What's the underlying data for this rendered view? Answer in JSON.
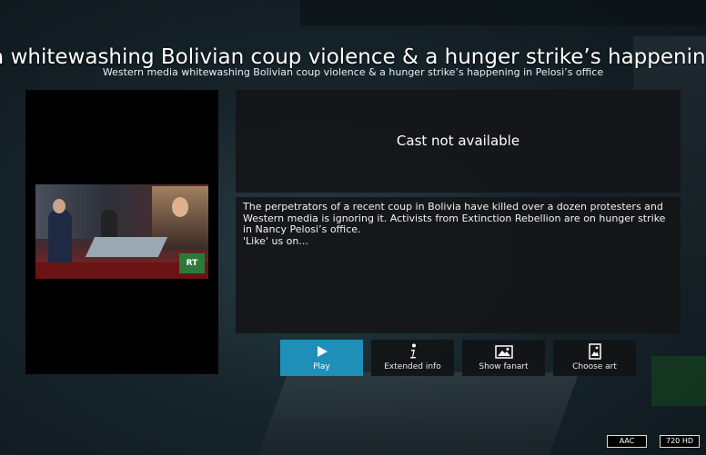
{
  "title": "Western media whitewashing Bolivian coup violence & a hunger strike’s happening in Pelosi’s office",
  "subtitle": "Western media whitewashing Bolivian coup violence & a hunger strike’s happening in Pelosi’s office",
  "thumbnail": {
    "logo_text": "RT"
  },
  "cast": {
    "message": "Cast not available"
  },
  "plot": {
    "text": "The perpetrators of a recent coup in Bolivia have killed over a dozen protesters and Western media is ignoring it. Activists from Extinction Rebellion are on hunger strike in Nancy Pelosi’s office.\n'Like' us on..."
  },
  "buttons": [
    {
      "label": "Play",
      "icon": "play-icon",
      "active": true
    },
    {
      "label": "Extended info",
      "icon": "info-icon",
      "active": false
    },
    {
      "label": "Show fanart",
      "icon": "image-icon",
      "active": false
    },
    {
      "label": "Choose art",
      "icon": "choose-art-icon",
      "active": false
    }
  ],
  "badges": {
    "audio": "AAC",
    "video": "720 HD"
  },
  "colors": {
    "accent": "#1d8fb8",
    "panel": "#141618"
  }
}
